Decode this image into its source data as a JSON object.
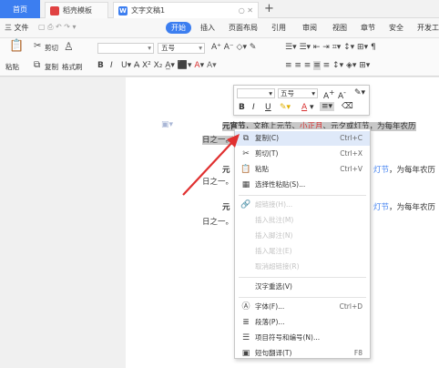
{
  "titlebar": {
    "tabs": [
      {
        "label": "首页"
      },
      {
        "label": "稻壳模板"
      },
      {
        "label": "文字文稿1"
      }
    ],
    "new_tab": "+"
  },
  "menubar": {
    "file": "三 文件",
    "items": [
      "开始",
      "插入",
      "页面布局",
      "引用",
      "审阅",
      "视图",
      "章节",
      "安全",
      "开发工"
    ]
  },
  "toolbar": {
    "paste": "粘贴",
    "cut": "剪切",
    "copy": "复制",
    "format_painter": "格式刷",
    "font_size": "五号",
    "font_name": ""
  },
  "document": {
    "lines": [
      {
        "bold": "元宵节",
        "text1": "，文称上元节、",
        "red": "小正月",
        "text2": "、元夕或灯节，为每年农历"
      },
      {
        "text": "日之一。"
      },
      {
        "bold": "元",
        "blue": "灯节",
        "text": "，为每年农历"
      },
      {
        "text": "日之一。"
      },
      {
        "bold": "元",
        "blue": "灯节",
        "text": "，为每年农历"
      },
      {
        "text": "日之一。"
      }
    ]
  },
  "minibar": {
    "font_name": "",
    "font_size": "五号",
    "grow": "A+",
    "shrink": "A-",
    "bold": "B",
    "italic": "I",
    "underline": "U",
    "font_color": "A"
  },
  "context_menu": {
    "items": [
      {
        "label": "复制(C)",
        "key": "Ctrl+C",
        "icon": "copy-icon",
        "enabled": true
      },
      {
        "label": "剪切(T)",
        "key": "Ctrl+X",
        "icon": "scissors-icon",
        "enabled": true
      },
      {
        "label": "粘贴",
        "key": "Ctrl+V",
        "icon": "paste-icon",
        "enabled": true
      },
      {
        "label": "选择性粘贴(S)...",
        "key": "",
        "icon": "paste-special-icon",
        "enabled": true
      },
      {
        "label": "超链接(H)...",
        "key": "",
        "icon": "link-icon",
        "enabled": false
      },
      {
        "label": "插入批注(M)",
        "key": "",
        "icon": "",
        "enabled": false
      },
      {
        "label": "插入脚注(N)",
        "key": "",
        "icon": "",
        "enabled": false
      },
      {
        "label": "插入尾注(E)",
        "key": "",
        "icon": "",
        "enabled": false
      },
      {
        "label": "取消超链接(R)",
        "key": "",
        "icon": "",
        "enabled": false
      },
      {
        "label": "汉字重选(V)",
        "key": "",
        "icon": "",
        "enabled": true
      },
      {
        "label": "字体(F)...",
        "key": "Ctrl+D",
        "icon": "font-icon",
        "enabled": true
      },
      {
        "label": "段落(P)...",
        "key": "",
        "icon": "paragraph-icon",
        "enabled": true
      },
      {
        "label": "项目符号和编号(N)...",
        "key": "",
        "icon": "list-icon",
        "enabled": true
      },
      {
        "label": "短句翻译(T)",
        "key": "F8",
        "icon": "translate-icon",
        "enabled": true
      }
    ]
  },
  "colors": {
    "accent": "#3c7ef0",
    "arrow": "#e03030"
  }
}
